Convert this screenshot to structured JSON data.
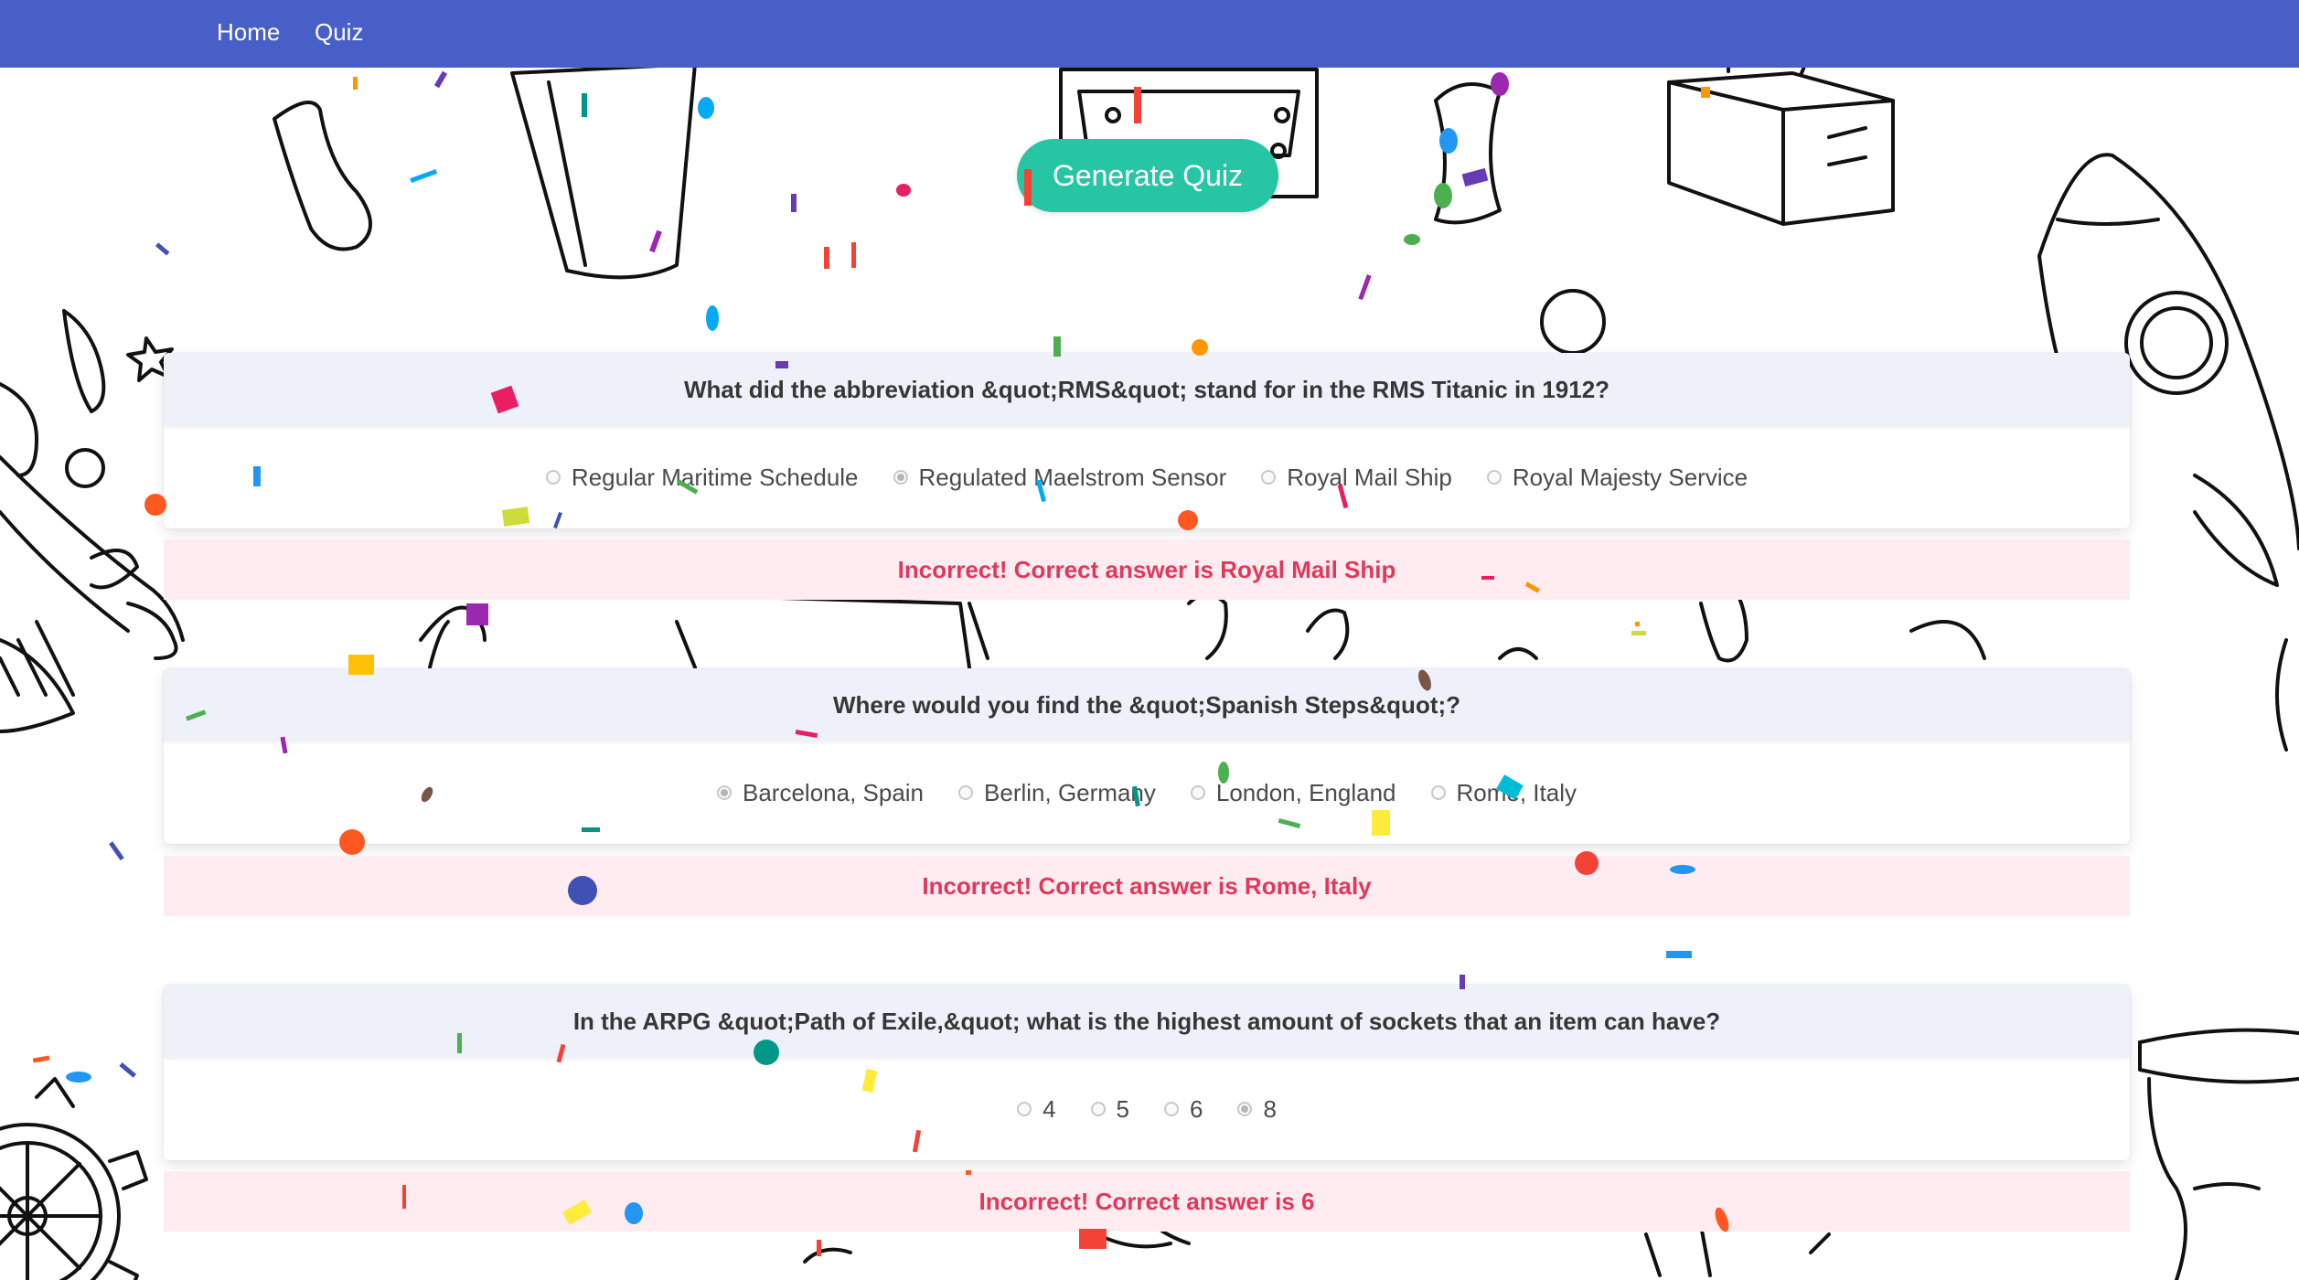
{
  "nav": {
    "home_label": "Home",
    "quiz_label": "Quiz"
  },
  "generate_button_label": "Generate Quiz",
  "colors": {
    "navbar": "#485fc7",
    "primary_button": "#26c6a4",
    "card_header": "#eff1fa",
    "feedback_background": "#feecf0",
    "feedback_text": "#e0385b"
  },
  "questions": [
    {
      "text": "What did the abbreviation &quot;RMS&quot; stand for in the RMS Titanic in 1912?",
      "options": [
        "Regular Maritime Schedule",
        "Regulated Maelstrom Sensor",
        "Royal Mail Ship",
        "Royal Majesty Service"
      ],
      "selected_index": 1,
      "feedback": "Incorrect! Correct answer is Royal Mail Ship"
    },
    {
      "text": "Where would you find the &quot;Spanish Steps&quot;?",
      "options": [
        "Barcelona, Spain",
        "Berlin, Germany",
        "London, England",
        "Rome, Italy"
      ],
      "selected_index": 0,
      "feedback": "Incorrect! Correct answer is Rome, Italy"
    },
    {
      "text": "In the ARPG &quot;Path of Exile,&quot; what is the highest amount of sockets that an item can have?",
      "options": [
        "4",
        "5",
        "6",
        "8"
      ],
      "selected_index": 3,
      "feedback": "Incorrect! Correct answer is 6"
    }
  ]
}
